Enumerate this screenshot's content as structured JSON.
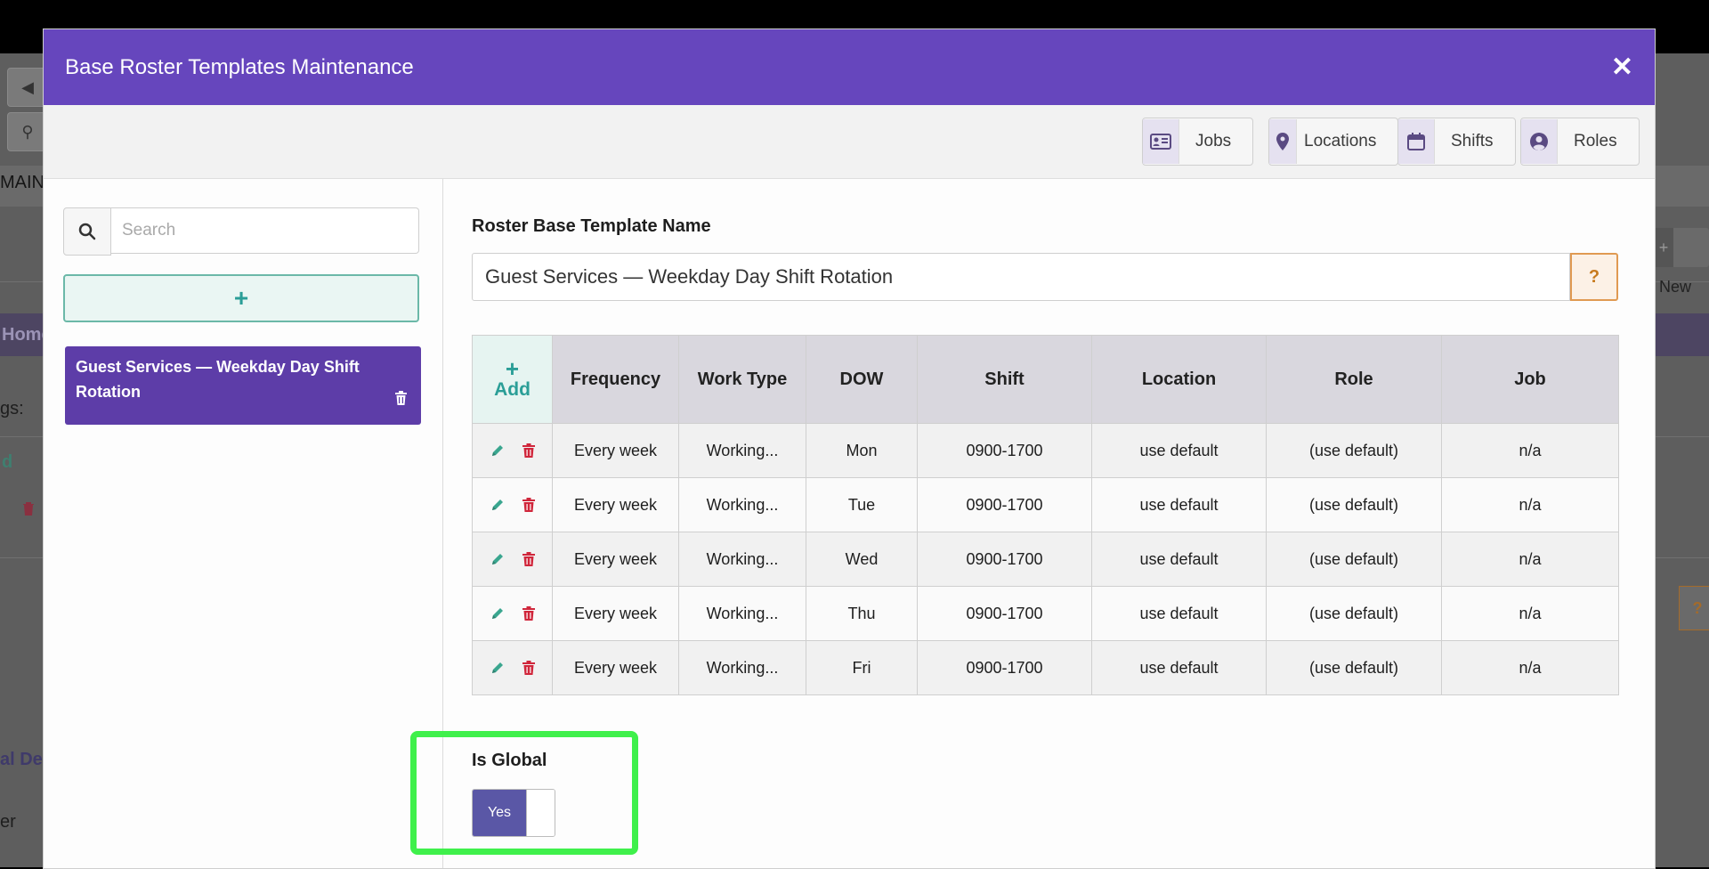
{
  "background": {
    "tab_label": "MAIN",
    "home_label": "Home",
    "settings_fragment": "gs:",
    "add_fragment": "d",
    "detail_fragment": "al De",
    "other_fragment": "er",
    "new_button_label": "New"
  },
  "modal": {
    "title": "Base Roster Templates Maintenance",
    "close_symbol": "✕"
  },
  "toolbar": {
    "buttons": [
      {
        "label": "Jobs",
        "icon": "id-card-icon"
      },
      {
        "label": "Locations",
        "icon": "map-pin-icon"
      },
      {
        "label": "Shifts",
        "icon": "calendar-icon"
      },
      {
        "label": "Roles",
        "icon": "user-circle-icon"
      }
    ]
  },
  "sidebar": {
    "search_placeholder": "Search",
    "add_symbol": "+",
    "templates": [
      {
        "name": "Guest Services — Weekday Day Shift Rotation",
        "selected": true
      }
    ]
  },
  "form": {
    "name_label": "Roster Base Template Name",
    "name_value": "Guest Services — Weekday Day Shift Rotation",
    "help_symbol": "?",
    "is_global_label": "Is Global",
    "is_global_value": "Yes"
  },
  "table": {
    "add_symbol": "+",
    "add_label": "Add",
    "headers": [
      "Frequency",
      "Work Type",
      "DOW",
      "Shift",
      "Location",
      "Role",
      "Job"
    ],
    "rows": [
      [
        "Every week",
        "Working...",
        "Mon",
        "0900-1700",
        "use default",
        "(use default)",
        "n/a"
      ],
      [
        "Every week",
        "Working...",
        "Tue",
        "0900-1700",
        "use default",
        "(use default)",
        "n/a"
      ],
      [
        "Every week",
        "Working...",
        "Wed",
        "0900-1700",
        "use default",
        "(use default)",
        "n/a"
      ],
      [
        "Every week",
        "Working...",
        "Thu",
        "0900-1700",
        "use default",
        "(use default)",
        "n/a"
      ],
      [
        "Every week",
        "Working...",
        "Fri",
        "0900-1700",
        "use default",
        "(use default)",
        "n/a"
      ]
    ]
  },
  "colors": {
    "header_purple": "#6646bd",
    "selected_item": "#5d3da8",
    "teal": "#2b9e97",
    "edit_icon": "#3aa68f",
    "delete_icon": "#d0263b",
    "help_orange": "#e09a52",
    "highlight_green": "#3ff04b"
  }
}
